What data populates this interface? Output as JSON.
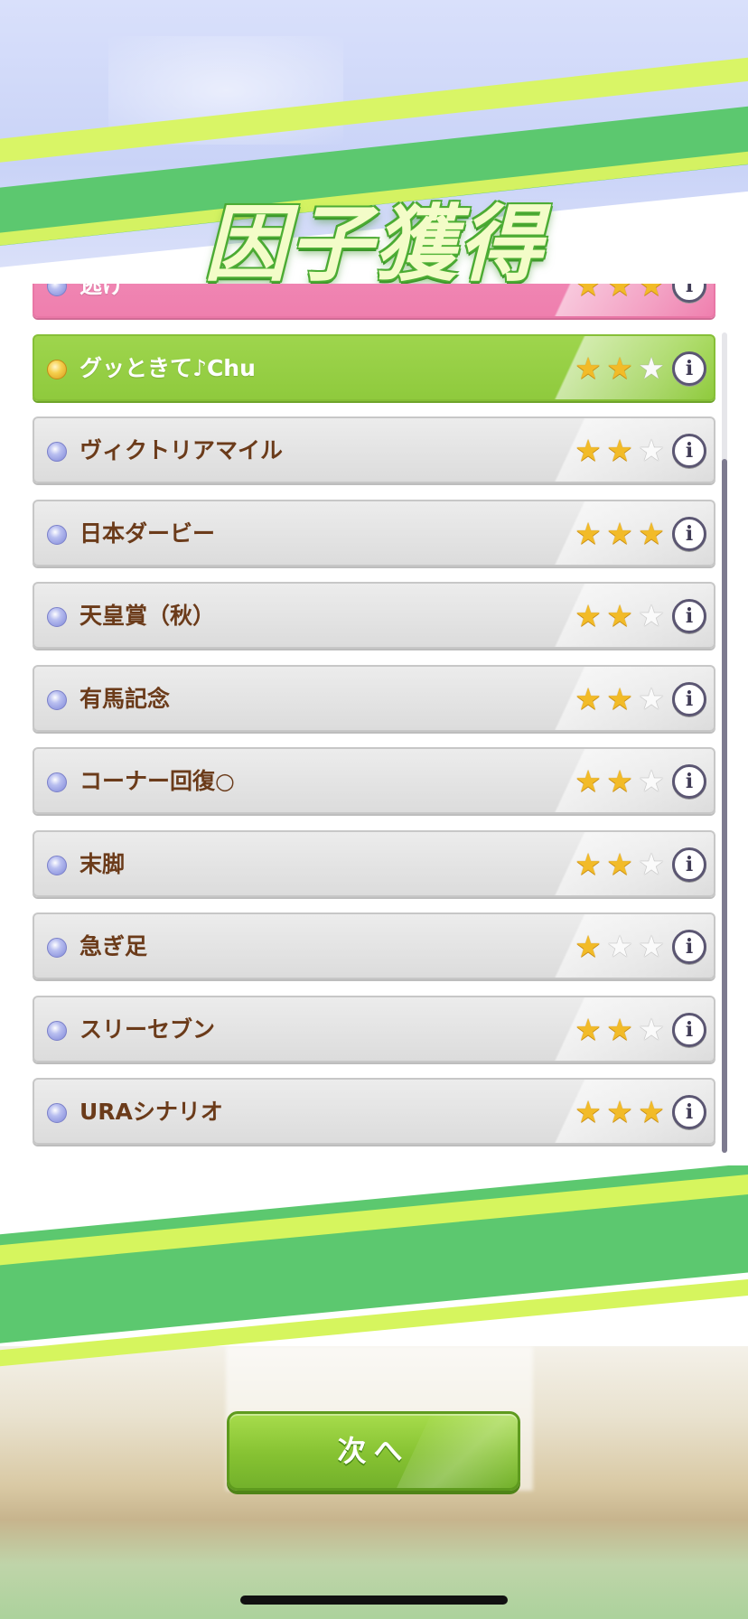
{
  "screen": {
    "title": "因子獲得"
  },
  "colors": {
    "stripe_green": "#5cc86f",
    "stripe_lime": "#d6f55e",
    "item_pink": "#ef7fae",
    "item_green": "#8fca3d",
    "item_gray": "#dcdcdc",
    "label_brown": "#6b3b1a",
    "star_gold": "#f2bb28",
    "button_green": "#86c232"
  },
  "factors": [
    {
      "label": "逃げ",
      "stars": 3,
      "style": "pink"
    },
    {
      "label": "グッときて♪Chu",
      "stars": 2,
      "style": "green"
    },
    {
      "label": "ヴィクトリアマイル",
      "stars": 2,
      "style": "gray"
    },
    {
      "label": "日本ダービー",
      "stars": 3,
      "style": "gray"
    },
    {
      "label": "天皇賞（秋）",
      "stars": 2,
      "style": "gray"
    },
    {
      "label": "有馬記念",
      "stars": 2,
      "style": "gray"
    },
    {
      "label": "コーナー回復○",
      "stars": 2,
      "style": "gray"
    },
    {
      "label": "末脚",
      "stars": 2,
      "style": "gray"
    },
    {
      "label": "急ぎ足",
      "stars": 1,
      "style": "gray"
    },
    {
      "label": "スリーセブン",
      "stars": 2,
      "style": "gray"
    },
    {
      "label": "URAシナリオ",
      "stars": 3,
      "style": "gray"
    }
  ],
  "max_stars": 3,
  "info_icon_glyph": "i",
  "star_glyph": "★",
  "next_button": {
    "label": "次へ"
  }
}
